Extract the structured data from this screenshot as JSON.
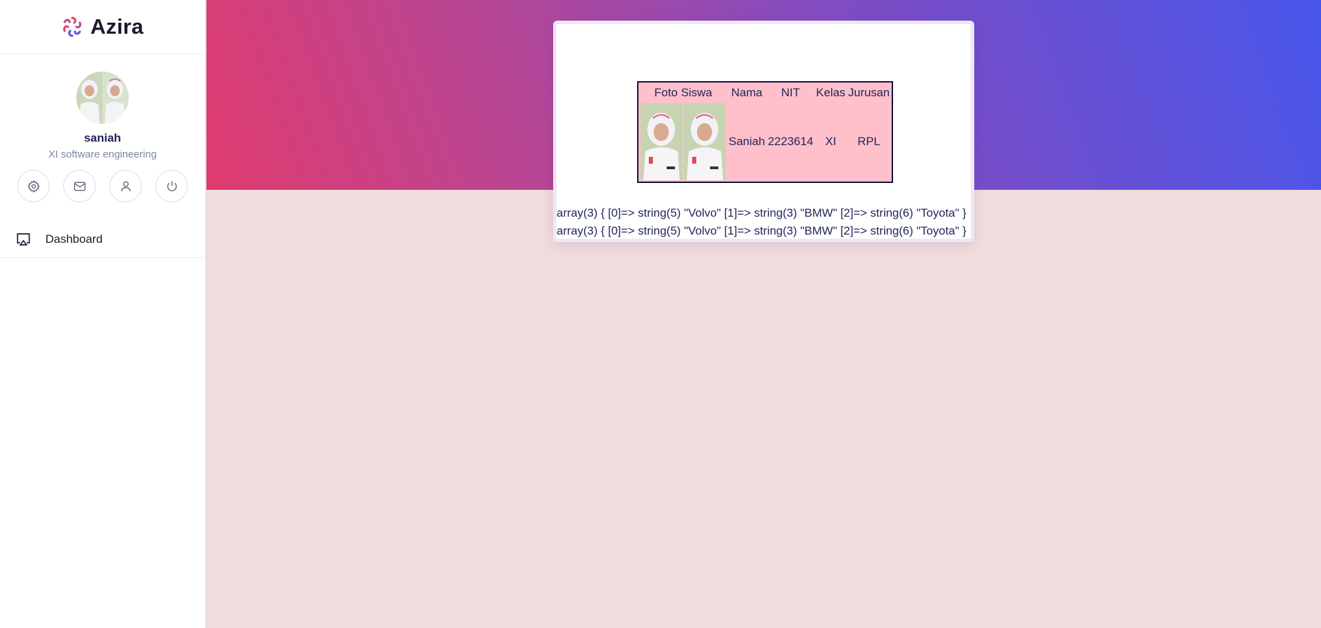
{
  "brand": {
    "name": "Azira"
  },
  "profile": {
    "name": "saniah",
    "role": "XI software engineering",
    "actions": [
      {
        "icon": "gear-icon"
      },
      {
        "icon": "mail-icon"
      },
      {
        "icon": "user-icon"
      },
      {
        "icon": "power-icon"
      }
    ]
  },
  "nav": {
    "items": [
      {
        "label": "Dashboard",
        "icon": "monitor-icon"
      }
    ]
  },
  "table": {
    "headers": [
      "Foto Siswa",
      "Nama",
      "NIT",
      "Kelas",
      "Jurusan"
    ],
    "rows": [
      {
        "nama": "Saniah",
        "nit": "2223614",
        "kelas": "XI",
        "jurusan": "RPL"
      }
    ]
  },
  "dump": {
    "lines": [
      "array(3) { [0]=> string(5) \"Volvo\" [1]=> string(3) \"BMW\" [2]=> string(6) \"Toyota\" }",
      "array(3) { [0]=> string(5) \"Volvo\" [1]=> string(3) \"BMW\" [2]=> string(6) \"Toyota\" }"
    ]
  },
  "colors": {
    "hero_start": "#df3b6f",
    "hero_end": "#4856ea",
    "table_bg": "#ffc0cb",
    "page_bg": "#f0dcdc"
  }
}
